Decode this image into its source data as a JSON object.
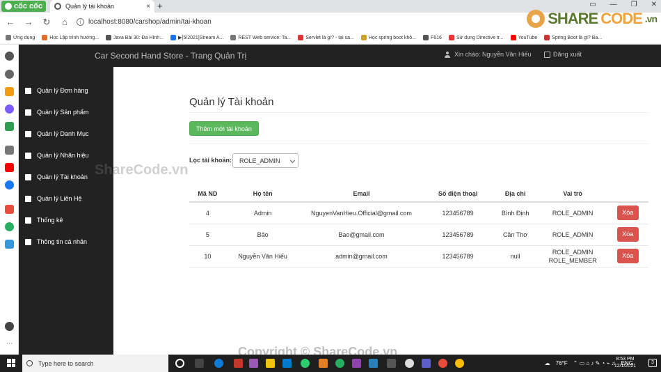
{
  "browser": {
    "brand": "cốc cốc",
    "tab_title": "Quản lý tài khoản",
    "tab_close": "×",
    "new_tab": "+",
    "url": "localhost:8080/carshop/admin/tai-khoan",
    "bookmarks": [
      {
        "label": "Ứng dụng",
        "color": "#777"
      },
      {
        "label": "Học Lập trình hướng...",
        "color": "#e06c2b"
      },
      {
        "label": "Java Bài 30: Đa Hình...",
        "color": "#555"
      },
      {
        "label": "▶[5/2021]Stream A...",
        "color": "#1a73e8"
      },
      {
        "label": "REST Web service: Ta...",
        "color": "#777"
      },
      {
        "label": "Servlet là gì? - tại sa...",
        "color": "#d33"
      },
      {
        "label": "Học spring boot khô...",
        "color": "#c9a227"
      },
      {
        "label": "F616",
        "color": "#555"
      },
      {
        "label": "Sử dụng Directive tr...",
        "color": "#e33"
      },
      {
        "label": "YouTube",
        "color": "#f00"
      },
      {
        "label": "Spring Boot là gì? Ba...",
        "color": "#c33"
      }
    ]
  },
  "sharecode_logo": {
    "share": "SHARE",
    "code": "CODE",
    "vn": ".vn"
  },
  "app": {
    "title": "Car Second Hand Store - Trang Quản Trị",
    "greeting": "Xin chào: Nguyễn Văn Hiếu",
    "logout": "Đăng xuất"
  },
  "sidebar": {
    "items": [
      {
        "label": "Quản lý Đơn hàng",
        "icon": "cart-icon"
      },
      {
        "label": "Quản lý Sản phẩm",
        "icon": "folder-icon"
      },
      {
        "label": "Quản lý Danh Mục",
        "icon": "list-icon"
      },
      {
        "label": "Quản lý Nhãn hiệu",
        "icon": "flag-icon"
      },
      {
        "label": "Quản lý Tài khoản",
        "icon": "list-icon"
      },
      {
        "label": "Quản lý Liên Hệ",
        "icon": "envelope-icon"
      },
      {
        "label": "Thống kê",
        "icon": "signal-icon"
      },
      {
        "label": "Thông tin cá nhân",
        "icon": "user-icon"
      }
    ]
  },
  "main": {
    "page_title": "Quản lý Tài khoản",
    "add_button": "Thêm mới tài khoản",
    "filter_label": "Lọc tài khoản:",
    "filter_value": "ROLE_ADMIN",
    "table": {
      "headers": [
        "Mã ND",
        "Họ tên",
        "Email",
        "Số điện thoại",
        "Địa chỉ",
        "Vai trò",
        ""
      ],
      "rows": [
        {
          "id": "4",
          "name": "Admin",
          "email": "NguyenVanHieu.Official@gmail.com",
          "phone": "123456789",
          "address": "Bình Định",
          "roles": [
            "ROLE_ADMIN"
          ],
          "delete": "Xóa"
        },
        {
          "id": "5",
          "name": "Bảo",
          "email": "Bao@gmail.com",
          "phone": "123456789",
          "address": "Cần Thơ",
          "roles": [
            "ROLE_ADMIN"
          ],
          "delete": "Xóa"
        },
        {
          "id": "10",
          "name": "Nguyễn Văn Hiếu",
          "email": "admin@gmail.com",
          "phone": "123456789",
          "address": "null",
          "roles": [
            "ROLE_ADMIN",
            "ROLE_MEMBER"
          ],
          "delete": "Xóa"
        }
      ]
    }
  },
  "watermarks": {
    "center": "ShareCode.vn",
    "bottom": "Copyright © ShareCode.vn"
  },
  "taskbar": {
    "search_placeholder": "Type here to search",
    "weather": "76°F",
    "lang": "ENG",
    "time": "8:53 PM",
    "date": "12/1/2021",
    "notification_count": "3"
  },
  "colors": {
    "header_bg": "#222222",
    "add_button": "#5cb85c",
    "delete_button": "#d9534f",
    "brand_green": "#4caf50"
  }
}
